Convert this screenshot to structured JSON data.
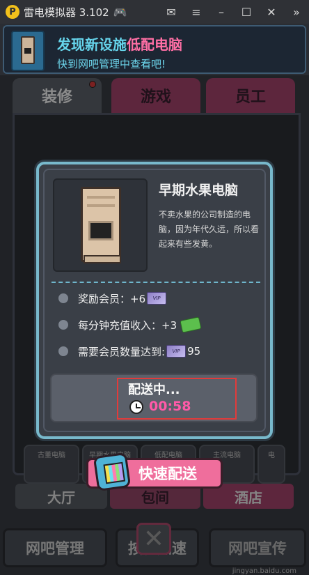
{
  "titlebar": {
    "logo": "P",
    "title": "雷电模拟器 3.102",
    "icons": [
      "gamepad-icon",
      "mail-icon",
      "menu-icon",
      "minimize-icon",
      "maximize-icon",
      "close-icon",
      "back-icon"
    ]
  },
  "notification": {
    "line1_prefix": "发现新设施",
    "line1_highlight": "低配电脑",
    "line2": "快到网吧管理中查看吧!"
  },
  "top_tabs": [
    {
      "label": "装修"
    },
    {
      "label": "游戏"
    },
    {
      "label": "员工"
    }
  ],
  "items": [
    {
      "label": "古董电脑"
    },
    {
      "label": "早期水果电脑"
    },
    {
      "label": "低配电脑"
    },
    {
      "label": "主流电脑"
    },
    {
      "label": "电"
    }
  ],
  "bottom_tabs": [
    {
      "label": "大厅"
    },
    {
      "label": "包间"
    },
    {
      "label": "酒店"
    }
  ],
  "footer": {
    "manage": "网吧管理",
    "speed": "按住加速",
    "promo": "网吧宣传",
    "watermark": "jingyan.baidu.com"
  },
  "modal": {
    "title": "早期水果电脑",
    "description": "不卖水果的公司制造的电脑，因为年代久远，所以看起来有些发黄。",
    "stats": {
      "member_label": "奖励会员：+6",
      "recharge_label": "每分钟充值收入：+3",
      "required_label": "需要会员数量达到:",
      "required_value": "95",
      "ticket_text": "VIP"
    },
    "delivery": {
      "status": "配送中...",
      "timer": "00:58"
    }
  },
  "quick_deliver": {
    "label": "快速配送"
  },
  "colors": {
    "accent_pink": "#ff5aa8",
    "modal_border": "#78b9cc",
    "highlight_red": "#e23b3b",
    "notify_cyan": "#66d5ec"
  }
}
